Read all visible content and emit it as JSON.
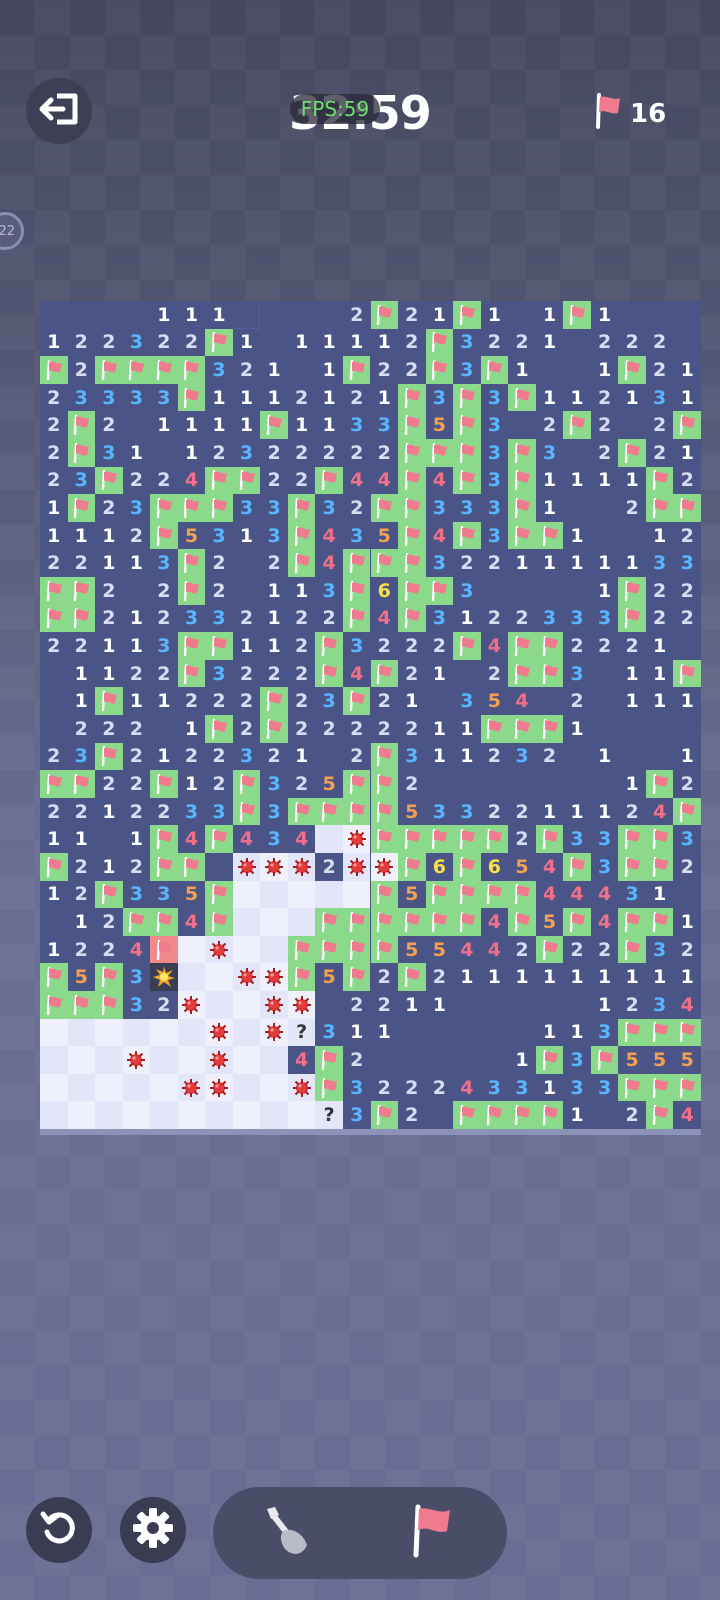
{
  "header": {
    "timer": "32:59",
    "fps_label": "FPS:59",
    "flags_remaining": "16",
    "level_badge": "22"
  },
  "board": {
    "cols": 24,
    "rows": 30,
    "legend": "h=hidden, n=open zero, f=flag, digits=revealed number, r/x=cleared white area, b=mine, F=exploded flag, q=question mark, X=exploded mine",
    "rows_data": [
      "....111h...2f21f1.1f1...",
      "122322f1.11112f3221.222.",
      "f2ffff321.1f22f3f1..1f211",
      "23333f1112121f3f3f112131f3",
      "2f2.1111f1133f5f3.2f2.2ff",
      "2f31.12322222fff3f3.2f21232",
      "23f224ff22f44f4f3f1111f2f31",
      "1f23fff33f32ff333f1..2ffff2",
      "1112f5313f435f4f3ff1..123f",
      "22113f2.2f4fff3221111133",
      "ff2.2f2.113f6ff3....1f22ff",
      "ff212332122f4f3122333f222",
      "22113ff112f3222f4ff2221.",
      ".1122f3222f4f21.2ff3.11f1.",
      ".1f11222f23f21.354.2.111.",
      ".222.1f2f2222211fff1.....",
      "23f2122321.2f311232.1..111",
      "ff22f12f325ff2.......1f2",
      "2212233f3ffff5332211124f",
      "11.1f4f434xbfffff2f33ff3f",
      "f212ff?bbb2bbf6f654f3ff221",
      "12f335fxxxxxf5ffff44431..",
      ".12ff4fxx ffffff4f5f4ff1",
      "1224Fxbx ffff55442f22f321",
      "f5f3Xxxbbf5f2f2111111111",
      "fff32bxxbb.2211.....12342f2",
      "xxxxxxbxbq311.....113fffff2",
      "xxxbxxbxx4f2.....1f3f555331",
      "xxxxxbbxxbf3222433133fff1",
      "xxxxxxxxxxq3f2.ffff1.2f421"
    ]
  },
  "cells": [],
  "controls": {
    "undo": "undo-icon",
    "settings": "gear-icon",
    "dig": "shovel-icon",
    "flag": "flag-icon"
  },
  "colors": {
    "board_hidden": "#4a5487",
    "flag_cell": "#8bd98a",
    "revealed_light": "#eef0fc",
    "mine_cell": "#3a3e54",
    "flag_red": "#f07a8e"
  }
}
